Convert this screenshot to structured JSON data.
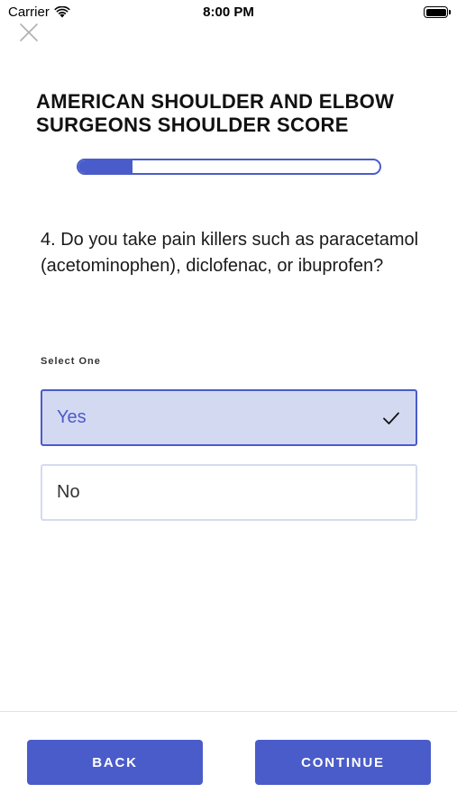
{
  "status_bar": {
    "carrier": "Carrier",
    "time": "8:00 PM",
    "icons": [
      "wifi-icon",
      "battery-icon"
    ]
  },
  "header": {
    "close_icon": "close-icon",
    "title": "AMERICAN SHOULDER AND ELBOW SURGEONS SHOULDER SCORE"
  },
  "progress": {
    "fraction": 0.18
  },
  "question": {
    "text": "4. Do you take pain killers such as paracetamol (acetominophen), diclofenac, or ibuprofen?"
  },
  "select_label": "Select One",
  "options": [
    {
      "label": "Yes",
      "selected": true,
      "check_icon": "checkmark-icon"
    },
    {
      "label": "No",
      "selected": false
    }
  ],
  "footer": {
    "back_label": "BACK",
    "continue_label": "CONTINUE"
  },
  "colors": {
    "accent": "#4a5cc9",
    "selected_bg": "#d4d9f2",
    "unselected_border": "#d5daf0"
  }
}
